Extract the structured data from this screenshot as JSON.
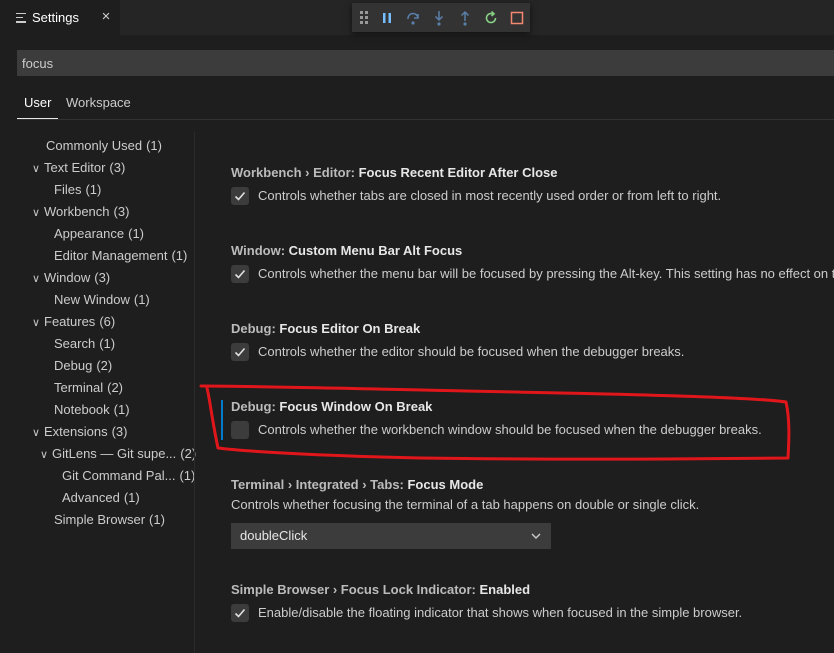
{
  "tab": {
    "title": "Settings",
    "close": "×"
  },
  "debug_toolbar": {
    "buttons": [
      "pause-icon",
      "step-over-icon",
      "step-into-icon",
      "step-out-icon",
      "restart-icon",
      "stop-icon"
    ],
    "colors": {
      "continue": "#75beff",
      "restart": "#89d185",
      "stop": "#f48771"
    }
  },
  "search": {
    "value": "focus"
  },
  "scope_tabs": {
    "user": "User",
    "workspace": "Workspace"
  },
  "toc": [
    {
      "label": "Commonly Used",
      "count": "(1)"
    },
    {
      "label": "Text Editor",
      "count": "(3)"
    },
    {
      "label": "Files",
      "count": "(1)"
    },
    {
      "label": "Workbench",
      "count": "(3)"
    },
    {
      "label": "Appearance",
      "count": "(1)"
    },
    {
      "label": "Editor Management",
      "count": "(1)"
    },
    {
      "label": "Window",
      "count": "(3)"
    },
    {
      "label": "New Window",
      "count": "(1)"
    },
    {
      "label": "Features",
      "count": "(6)"
    },
    {
      "label": "Search",
      "count": "(1)"
    },
    {
      "label": "Debug",
      "count": "(2)"
    },
    {
      "label": "Terminal",
      "count": "(2)"
    },
    {
      "label": "Notebook",
      "count": "(1)"
    },
    {
      "label": "Extensions",
      "count": "(3)"
    },
    {
      "label": "GitLens — Git supe...",
      "count": "(2)"
    },
    {
      "label": "Git Command Pal...",
      "count": "(1)"
    },
    {
      "label": "Advanced",
      "count": "(1)"
    },
    {
      "label": "Simple Browser",
      "count": "(1)"
    }
  ],
  "settings": [
    {
      "category": "Workbench › Editor: ",
      "name": "Focus Recent Editor After Close",
      "checked": true,
      "description": "Controls whether tabs are closed in most recently used order or from left to right."
    },
    {
      "category": "Window: ",
      "name": "Custom Menu Bar Alt Focus",
      "checked": true,
      "description": "Controls whether the menu bar will be focused by pressing the Alt-key. This setting has no effect on t"
    },
    {
      "category": "Debug: ",
      "name": "Focus Editor On Break",
      "checked": true,
      "description": "Controls whether the editor should be focused when the debugger breaks."
    },
    {
      "category": "Debug: ",
      "name": "Focus Window On Break",
      "checked": false,
      "description": "Controls whether the workbench window should be focused when the debugger breaks."
    },
    {
      "category": "Terminal › Integrated › Tabs: ",
      "name": "Focus Mode",
      "description": "Controls whether focusing the terminal of a tab happens on double or single click.",
      "select_value": "doubleClick"
    },
    {
      "category": "Simple Browser › Focus Lock Indicator: ",
      "name": "Enabled",
      "checked": true,
      "description": "Enable/disable the floating indicator that shows when focused in the simple browser."
    }
  ],
  "annotation": {
    "color": "#e0161b"
  }
}
